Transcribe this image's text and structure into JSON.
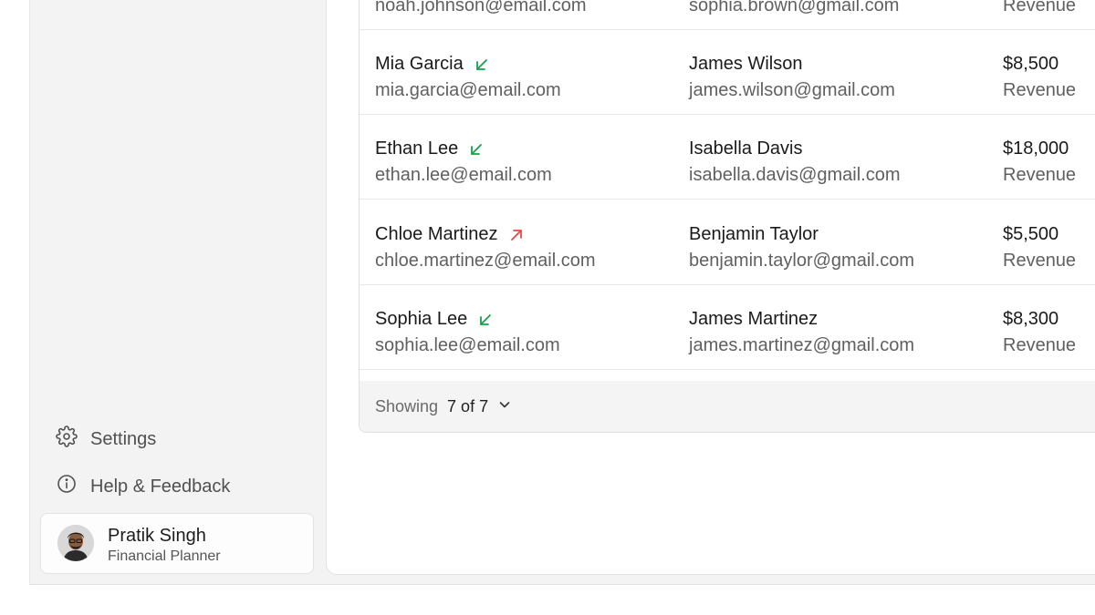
{
  "sidebar": {
    "settings_label": "Settings",
    "help_label": "Help & Feedback",
    "profile": {
      "name": "Pratik Singh",
      "role": "Financial Planner"
    }
  },
  "table": {
    "rows": [
      {
        "name": "",
        "email": "noah.johnson@email.com",
        "contact_name": "",
        "contact_email": "sophia.brown@gmail.com",
        "amount": "",
        "amount_label": "Revenue",
        "trend": ""
      },
      {
        "name": "Mia Garcia",
        "email": "mia.garcia@email.com",
        "contact_name": "James Wilson",
        "contact_email": "james.wilson@gmail.com",
        "amount": "$8,500",
        "amount_label": "Revenue",
        "trend": "down"
      },
      {
        "name": "Ethan Lee",
        "email": "ethan.lee@email.com",
        "contact_name": "Isabella Davis",
        "contact_email": "isabella.davis@gmail.com",
        "amount": "$18,000",
        "amount_label": "Revenue",
        "trend": "down"
      },
      {
        "name": "Chloe Martinez",
        "email": "chloe.martinez@email.com",
        "contact_name": "Benjamin Taylor",
        "contact_email": "benjamin.taylor@gmail.com",
        "amount": "$5,500",
        "amount_label": "Revenue",
        "trend": "up"
      },
      {
        "name": "Sophia Lee",
        "email": "sophia.lee@email.com",
        "contact_name": "James Martinez",
        "contact_email": "james.martinez@gmail.com",
        "amount": "$8,300",
        "amount_label": "Revenue",
        "trend": "down"
      }
    ],
    "footer": {
      "showing_label": "Showing",
      "showing_value": "7 of 7"
    }
  },
  "colors": {
    "trend_down": "#16a34a",
    "trend_up": "#e5484d"
  },
  "icons": {
    "settings": "gear-icon",
    "help": "info-icon",
    "trend_down": "arrow-down-left-icon",
    "trend_up": "arrow-up-right-icon",
    "dropdown": "chevron-down-icon"
  }
}
